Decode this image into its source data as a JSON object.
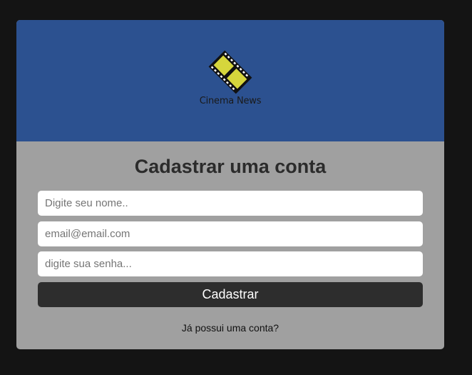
{
  "brand": {
    "logo_icon": "film-strip-icon",
    "name": "Cinema News",
    "header_color": "#2c5190",
    "logo_color": "#d6d63c"
  },
  "form": {
    "title": "Cadastrar uma conta",
    "name_placeholder": "Digite seu nome..",
    "email_placeholder": "email@email.com",
    "password_placeholder": "digite sua senha...",
    "submit_label": "Cadastrar",
    "login_link": "Já possui uma conta?"
  }
}
